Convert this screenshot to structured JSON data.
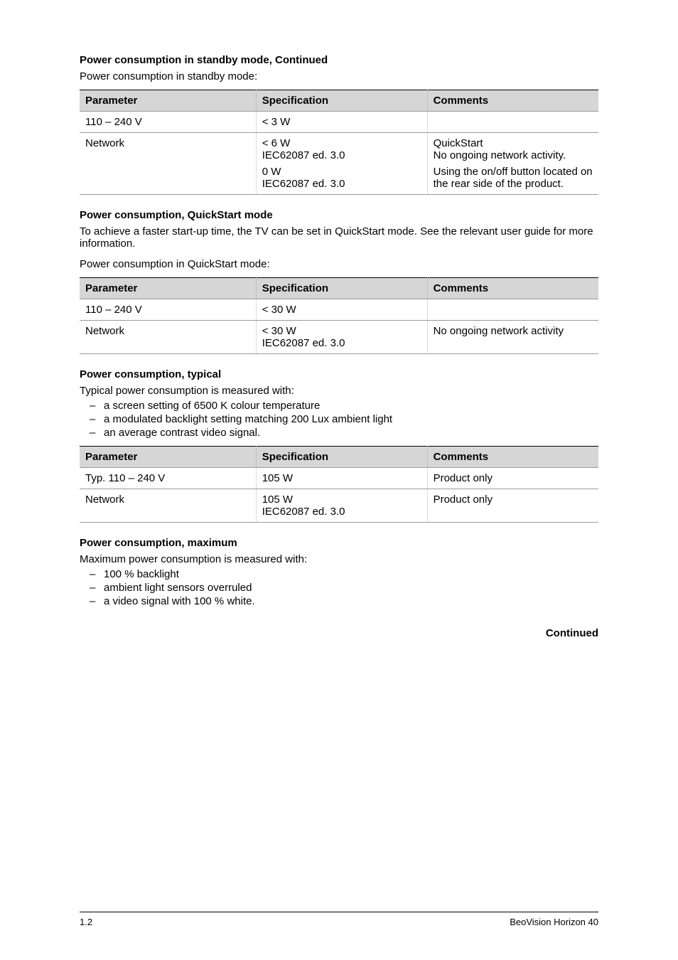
{
  "section1": {
    "heading": "Power consumption in standby mode, Continued",
    "tableCaption": "Power consumption in standby mode:",
    "headers": {
      "c1": "Parameter",
      "c2": "Specification",
      "c3": "Comments"
    },
    "rows": [
      {
        "c1": "110 – 240 V",
        "c2": "< 3 W",
        "c3": ""
      },
      {
        "c1": "Network",
        "c2l1": "< 6 W",
        "c2l2": "IEC62087 ed. 3.0",
        "c2l3": "0 W",
        "c2l4": "IEC62087 ed. 3.0",
        "c3l1": "QuickStart",
        "c3l2": "No ongoing network activity.",
        "c3l3": "Using the on/off button located on the rear side of the product."
      }
    ]
  },
  "section2": {
    "heading": "Power consumption, QuickStart mode",
    "intro": "To achieve a faster start-up time, the TV can be set in QuickStart mode. See the relevant user guide for more information.",
    "tableCaption": "Power consumption in QuickStart mode:",
    "headers": {
      "c1": "Parameter",
      "c2": "Specification",
      "c3": "Comments"
    },
    "rows": [
      {
        "c1": "110 – 240 V",
        "c2": "< 30 W",
        "c3": ""
      },
      {
        "c1": "Network",
        "c2l1": "< 30 W",
        "c2l2": "IEC62087 ed. 3.0",
        "c3": "No ongoing network activity"
      }
    ]
  },
  "section3": {
    "heading": "Power consumption, typical",
    "intro": "Typical power consumption is measured with:",
    "bullets": [
      "a screen setting of 6500 K colour temperature",
      "a modulated backlight setting matching 200 Lux ambient light",
      "an average contrast video signal."
    ],
    "headers": {
      "c1": "Parameter",
      "c2": "Specification",
      "c3": "Comments"
    },
    "rows": [
      {
        "c1": "Typ. 110 – 240 V",
        "c2": "105 W",
        "c3": "Product only"
      },
      {
        "c1": "Network",
        "c2l1": "105 W",
        "c2l2": "IEC62087 ed. 3.0",
        "c3": "Product only"
      }
    ]
  },
  "section4": {
    "heading": "Power consumption, maximum",
    "intro": "Maximum power consumption is measured with:",
    "bullets": [
      "100 % backlight",
      "ambient light sensors overruled",
      "a video signal with 100 % white."
    ]
  },
  "continued": "Continued",
  "footer": {
    "left": "1.2",
    "right": "BeoVision Horizon 40"
  }
}
